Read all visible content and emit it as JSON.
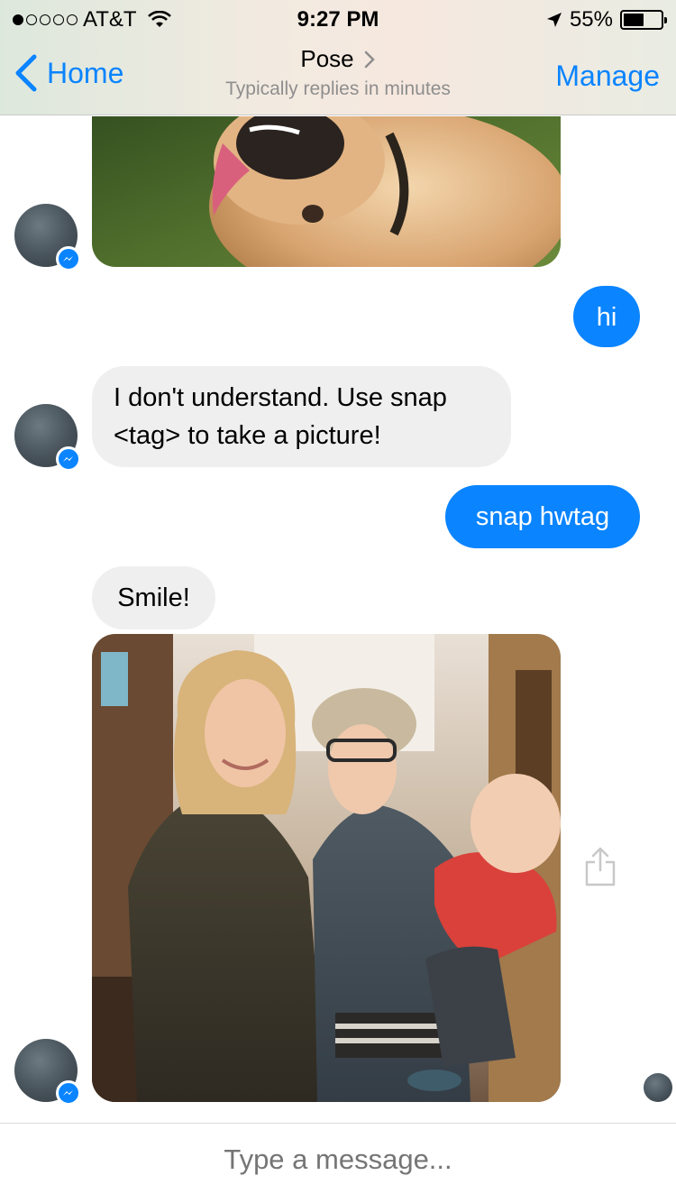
{
  "status_bar": {
    "carrier": "AT&T",
    "time": "9:27 PM",
    "battery": "55%",
    "battery_level": 0.55
  },
  "header": {
    "back_label": "Home",
    "title": "Pose",
    "subtitle": "Typically replies in minutes",
    "manage_label": "Manage"
  },
  "messages": [
    {
      "from": "bot",
      "type": "image",
      "content": "dog photo"
    },
    {
      "from": "user",
      "type": "text",
      "text": "hi"
    },
    {
      "from": "bot",
      "type": "text",
      "text": "I don't understand. Use snap <tag> to take a picture!"
    },
    {
      "from": "user",
      "type": "text",
      "text": "snap hwtag"
    },
    {
      "from": "bot",
      "type": "text",
      "text": "Smile!"
    },
    {
      "from": "bot",
      "type": "image",
      "content": "group photo"
    }
  ],
  "composer": {
    "placeholder": "Type a message..."
  },
  "colors": {
    "accent": "#0a84ff",
    "incoming_bubble": "#efefef"
  },
  "icons": [
    "wifi-icon",
    "location-arrow-icon",
    "battery-icon",
    "back-chevron-icon",
    "chevron-right-icon",
    "messenger-badge-icon",
    "share-icon"
  ]
}
